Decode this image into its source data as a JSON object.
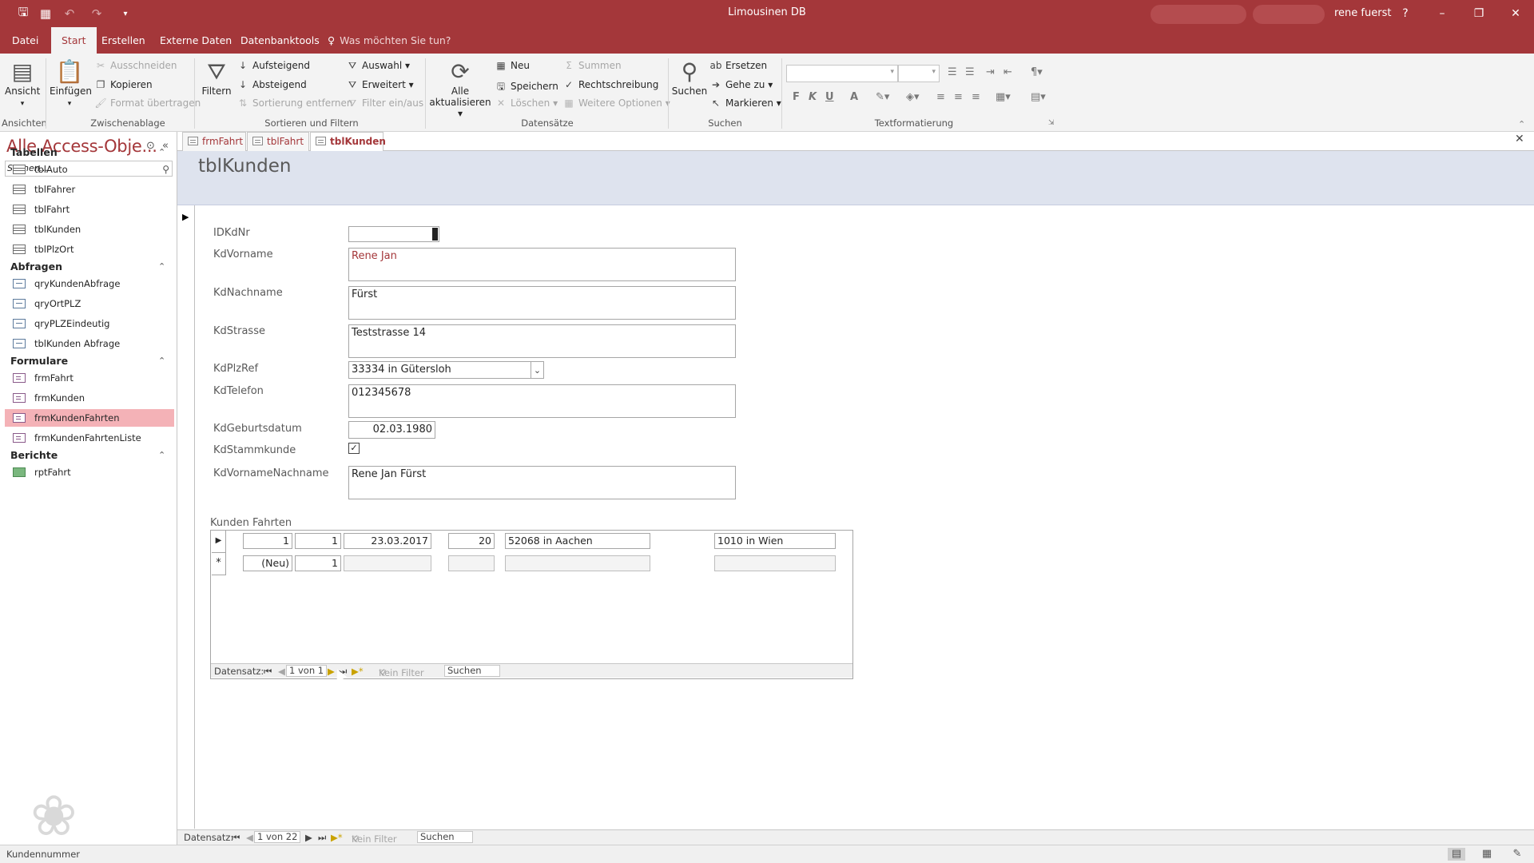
{
  "window": {
    "title": "Limousinen DB",
    "user": "rene fuerst",
    "help": "?",
    "minimize": "–",
    "restore": "❐",
    "close": "✕"
  },
  "menu": {
    "tabs": [
      "Datei",
      "Start",
      "Erstellen",
      "Externe Daten",
      "Datenbanktools"
    ],
    "active": "Start",
    "tell_me": "Was möchten Sie tun?"
  },
  "ribbon": {
    "ansicht": "Ansicht",
    "einfuegen": "Einfügen",
    "ausschneiden": "Ausschneiden",
    "kopieren": "Kopieren",
    "format": "Format übertragen",
    "filtern": "Filtern",
    "aufsteigend": "Aufsteigend",
    "absteigend": "Absteigend",
    "sortierung": "Sortierung entfernen",
    "auswahl": "Auswahl",
    "erweitert": "Erweitert",
    "filter_ein": "Filter ein/aus",
    "alle1": "Alle",
    "alle2": "aktualisieren",
    "neu": "Neu",
    "speichern": "Speichern",
    "loeschen": "Löschen",
    "summen": "Summen",
    "rechtschreibung": "Rechtschreibung",
    "weitere": "Weitere Optionen",
    "suchen": "Suchen",
    "ersetzen": "Ersetzen",
    "gehe_zu": "Gehe zu",
    "markieren": "Markieren",
    "fmt_bold": "F",
    "fmt_italic": "K",
    "fmt_underline": "U",
    "fmt_color": "A",
    "groups": {
      "ansichten": "Ansichten",
      "zwischenablage": "Zwischenablage",
      "sortieren": "Sortieren und Filtern",
      "datensaetze": "Datensätze",
      "suchen": "Suchen",
      "text": "Textformatierung"
    }
  },
  "doc_tabs": [
    "frmFahrt",
    "tblFahrt",
    "tblKunden"
  ],
  "nav": {
    "title": "Alle Access-Obje...",
    "search_placeholder": "Suchen...",
    "sections": [
      {
        "title": "Tabellen",
        "kind": "tbl",
        "items": [
          "tblAuto",
          "tblFahrer",
          "tblFahrt",
          "tblKunden",
          "tblPlzOrt"
        ]
      },
      {
        "title": "Abfragen",
        "kind": "qry",
        "items": [
          "qryKundenAbfrage",
          "qryOrtPLZ",
          "qryPLZEindeutig",
          "tblKunden Abfrage"
        ]
      },
      {
        "title": "Formulare",
        "kind": "frm",
        "items": [
          "frmFahrt",
          "frmKunden",
          "frmKundenFahrten",
          "frmKundenFahrtenListe"
        ]
      },
      {
        "title": "Berichte",
        "kind": "rpt",
        "items": [
          "rptFahrt"
        ]
      }
    ],
    "selected": "frmKundenFahrten"
  },
  "form": {
    "title": "tblKunden",
    "fields": {
      "IDKdNr": {
        "label": "IDKdNr",
        "value": ""
      },
      "KdVorname": {
        "label": "KdVorname",
        "value": "Rene Jan"
      },
      "KdNachname": {
        "label": "KdNachname",
        "value": "Fürst"
      },
      "KdStrasse": {
        "label": "KdStrasse",
        "value": "Teststrasse 14"
      },
      "KdPlzRef": {
        "label": "KdPlzRef",
        "value": "33334 in Gütersloh"
      },
      "KdTelefon": {
        "label": "KdTelefon",
        "value": "012345678"
      },
      "KdGeburtsdatum": {
        "label": "KdGeburtsdatum",
        "value": "02.03.1980"
      },
      "KdStammkunde": {
        "label": "KdStammkunde",
        "checked": true,
        "mark": "✓"
      },
      "KdVornameNachname": {
        "label": "KdVornameNachname",
        "value": "Rene Jan Fürst"
      }
    }
  },
  "subform": {
    "label": "Kunden Fahrten",
    "rows": [
      [
        "1",
        "1",
        "23.03.2017",
        "20",
        "52068 in Aachen",
        "1010 in Wien"
      ],
      [
        "(Neu)",
        "1",
        "",
        "",
        "",
        ""
      ]
    ],
    "nav": {
      "label": "Datensatz:",
      "position": "1 von 1",
      "filter": "Kein Filter",
      "search": "Suchen"
    }
  },
  "main_nav": {
    "label": "Datensatz:",
    "position": "1 von 22",
    "filter": "Kein Filter",
    "search": "Suchen"
  },
  "status": {
    "text": "Kundennummer"
  }
}
